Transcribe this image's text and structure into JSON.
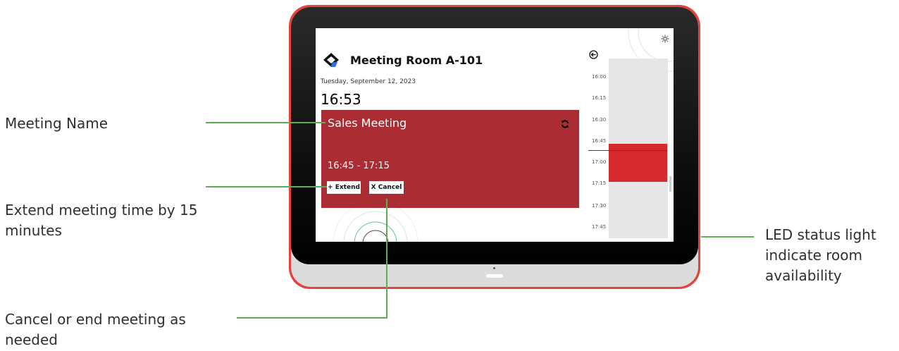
{
  "callouts": {
    "meeting_name": "Meeting Name",
    "extend": [
      "Extend meeting time by 15",
      "minutes"
    ],
    "cancel": [
      "Cancel or end meeting as",
      "needed"
    ],
    "led": [
      "LED status light",
      "indicate room",
      "availability"
    ]
  },
  "screen": {
    "room_name": "Meeting Room A-101",
    "date": "Tuesday, September 12, 2023",
    "clock": "16:53",
    "meeting": {
      "title": "Sales Meeting",
      "time_range": "16:45 - 17:15",
      "extend_label": "+ Extend",
      "cancel_label": "X Cancel"
    },
    "timeline": {
      "ticks": [
        "16:00",
        "16:15",
        "16:30",
        "16:45",
        "17:00",
        "17:15",
        "17:30",
        "17:45"
      ],
      "booked_from": "16:45",
      "booked_to": "17:15",
      "current_time": "16:53"
    }
  },
  "colors": {
    "frame_led": "#e8403a",
    "meeting_card": "#ab2d34",
    "booked_block": "#d52a2f",
    "leader_line": "#5cb04f"
  },
  "icons": {
    "logo": "room-logo-icon",
    "refresh": "refresh-icon",
    "back": "back-arrow-icon",
    "settings": "gear-icon"
  }
}
